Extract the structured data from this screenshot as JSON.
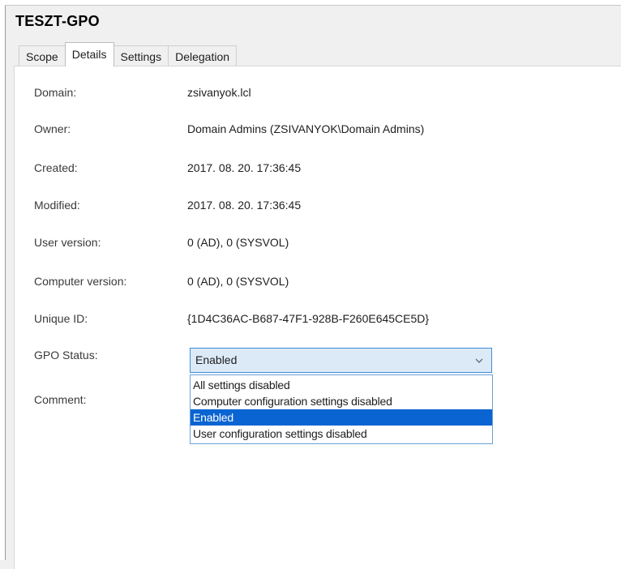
{
  "gpo": {
    "title": "TESZT-GPO"
  },
  "tabs": [
    {
      "label": "Scope",
      "active": false
    },
    {
      "label": "Details",
      "active": true
    },
    {
      "label": "Settings",
      "active": false
    },
    {
      "label": "Delegation",
      "active": false
    }
  ],
  "details": {
    "domain": {
      "label": "Domain:",
      "value": "zsivanyok.lcl"
    },
    "owner": {
      "label": "Owner:",
      "value": "Domain Admins (ZSIVANYOK\\Domain Admins)"
    },
    "created": {
      "label": "Created:",
      "value": "2017. 08. 20. 17:36:45"
    },
    "modified": {
      "label": "Modified:",
      "value": "2017. 08. 20. 17:36:45"
    },
    "user_version": {
      "label": "User version:",
      "value": "0 (AD), 0 (SYSVOL)"
    },
    "computer_version": {
      "label": "Computer version:",
      "value": "0 (AD), 0 (SYSVOL)"
    },
    "unique_id": {
      "label": "Unique ID:",
      "value": "{1D4C36AC-B687-47F1-928B-F260E645CE5D}"
    },
    "gpo_status": {
      "label": "GPO Status:",
      "value": "Enabled"
    },
    "comment": {
      "label": "Comment:"
    }
  },
  "gpo_status_options": [
    "All settings disabled",
    "Computer configuration settings disabled",
    "Enabled",
    "User configuration settings disabled"
  ],
  "colors": {
    "selection": "#0a64d2",
    "combo_focus_border": "#3c8fd8",
    "combo_focus_bg": "#dce9f7"
  },
  "icons": {
    "dropdown": "chevron-down-icon"
  }
}
